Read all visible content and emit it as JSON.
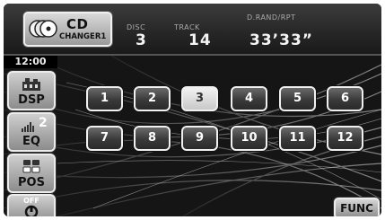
{
  "source": {
    "title": "CD",
    "subtitle": "CHANGER1",
    "icon": "cd-changer-icon"
  },
  "disc": {
    "label": "DISC",
    "value": "3"
  },
  "track": {
    "label": "TRACK",
    "value": "14"
  },
  "time": {
    "label": "D.RAND/RPT",
    "value": "33’33”"
  },
  "clock": "12:00",
  "side_buttons": [
    {
      "label": "DSP",
      "icon": "dsp-icon"
    },
    {
      "label": "EQ",
      "icon": "equalizer-icon",
      "badge": "2"
    },
    {
      "label": "POS",
      "icon": "seat-position-icon"
    },
    {
      "label": "OFF",
      "icon": "power-off-speaker-icon"
    }
  ],
  "presets": {
    "row1": [
      "1",
      "2",
      "3",
      "4",
      "5",
      "6"
    ],
    "row2": [
      "7",
      "8",
      "9",
      "10",
      "11",
      "12"
    ],
    "active": "3"
  },
  "func_label": "FUNC",
  "colors": {
    "background": "#101010",
    "button_face": "#4a4a4a",
    "active_button": "#e6e6e6"
  }
}
